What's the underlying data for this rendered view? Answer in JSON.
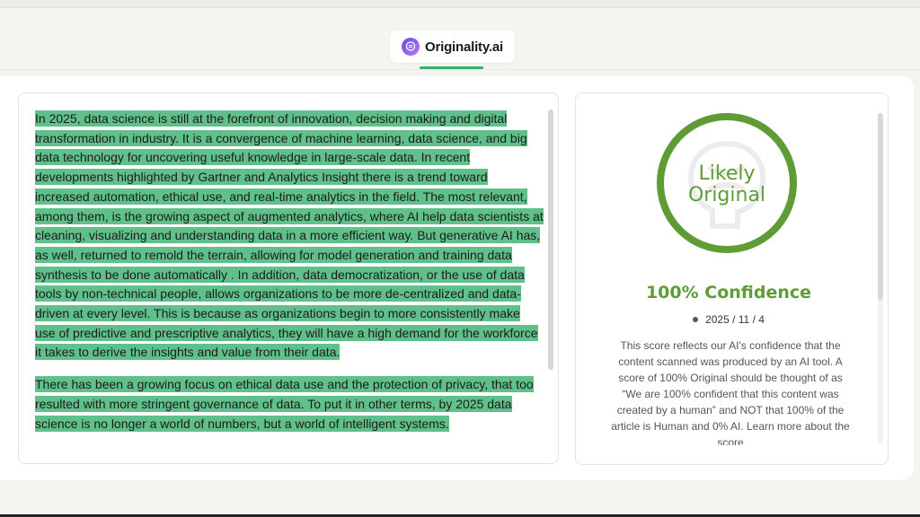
{
  "brand": {
    "name": "Originality.ai",
    "logo_icon": "brain-logo-icon",
    "accent_color": "#2fb26b"
  },
  "document": {
    "highlight_color": "#5fc08a",
    "paragraphs": [
      " In 2025, data science is still at the forefront of innovation, decision making and digital transformation in industry.  It is a convergence of machine learning, data science, and big data technology for uncovering useful knowledge in large-scale data.  In recent developments highlighted by Gartner and Analytics Insight there is a trend toward increased automation, ethical use, and real-time analytics in the field.  The most relevant, among them, is the growing aspect of augmented analytics, where AI help data scientists at cleaning, visualizing and understanding data in a more efficient way.  But generative AI has, as well, returned to remold the terrain, allowing for model generation and training data synthesis to be done automatically .  In addition, data democratization, or the use of data tools by non-technical people, allows organizations to be more de-centralized and data- driven at every level.  This is because as organizations begin to more consistently make use of predictive and prescriptive analytics, they will have a high demand for the workforce it takes to derive the insights and value from their data.",
      " There has been a growing focus on ethical data use and the protection of privacy, that too resulted with more stringent governance of data.  To put it in other terms, by 2025 data science is no longer a world of numbers, but a world of intelligent systems."
    ]
  },
  "result": {
    "verdict_line1": "Likely",
    "verdict_line2": "Original",
    "original_percent": 100,
    "gauge_color": "#5f9c36",
    "gauge_icon": "brain-watermark-icon",
    "confidence_label": "100% Confidence",
    "date": "2025 / 11 / 4",
    "explanation": "This score reflects our AI's confidence that the content scanned was produced by an AI tool. A score of 100% Original should be thought of as “We are 100% confident that this content was created by a human” and NOT that 100% of the article is Human and 0% AI. Learn more about the score"
  }
}
